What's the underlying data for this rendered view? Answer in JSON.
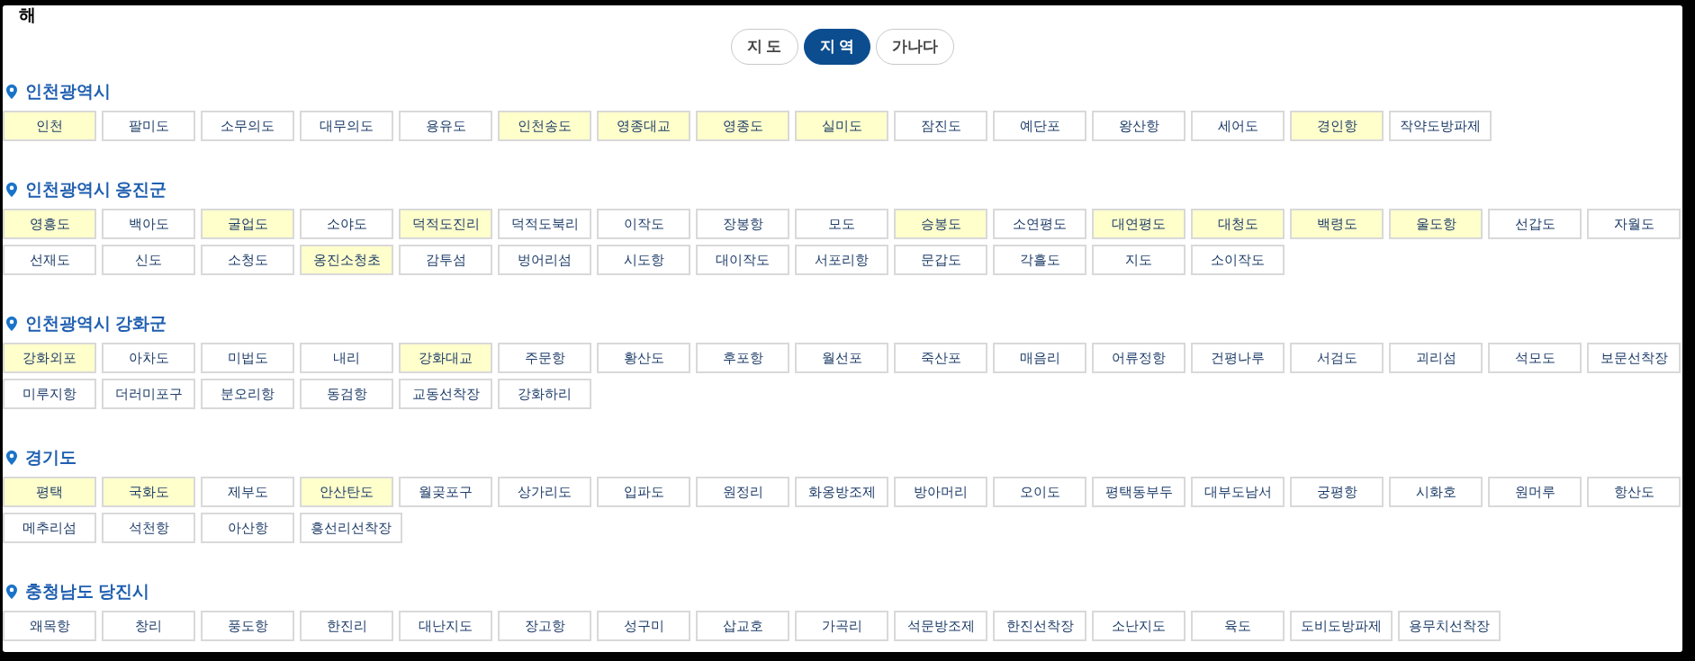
{
  "header": {
    "title": "해"
  },
  "view_tabs": [
    {
      "label": "지 도",
      "selected": false
    },
    {
      "label": "지 역",
      "selected": true
    },
    {
      "label": "가나다",
      "selected": false
    }
  ],
  "regions": [
    {
      "name": "인천광역시",
      "rows": [
        {
          "places": [
            {
              "label": "인천",
              "highlighted": true
            },
            {
              "label": "팔미도",
              "highlighted": false
            },
            {
              "label": "소무의도",
              "highlighted": false
            },
            {
              "label": "대무의도",
              "highlighted": false
            },
            {
              "label": "용유도",
              "highlighted": false
            },
            {
              "label": "인천송도",
              "highlighted": true
            },
            {
              "label": "영종대교",
              "highlighted": true
            },
            {
              "label": "영종도",
              "highlighted": true
            },
            {
              "label": "실미도",
              "highlighted": true
            },
            {
              "label": "잠진도",
              "highlighted": false
            },
            {
              "label": "예단포",
              "highlighted": false
            },
            {
              "label": "왕산항",
              "highlighted": false
            },
            {
              "label": "세어도",
              "highlighted": false
            },
            {
              "label": "경인항",
              "highlighted": true
            },
            {
              "label": "작약도방파제",
              "highlighted": false
            }
          ]
        }
      ]
    },
    {
      "name": "인천광역시 옹진군",
      "rows": [
        {
          "places": [
            {
              "label": "영흥도",
              "highlighted": true
            },
            {
              "label": "백아도",
              "highlighted": false
            },
            {
              "label": "굴업도",
              "highlighted": true
            },
            {
              "label": "소야도",
              "highlighted": false
            },
            {
              "label": "덕적도진리",
              "highlighted": true
            },
            {
              "label": "덕적도북리",
              "highlighted": false
            },
            {
              "label": "이작도",
              "highlighted": false
            },
            {
              "label": "장봉항",
              "highlighted": false
            },
            {
              "label": "모도",
              "highlighted": false
            },
            {
              "label": "승봉도",
              "highlighted": true
            },
            {
              "label": "소연평도",
              "highlighted": false
            },
            {
              "label": "대연평도",
              "highlighted": true
            },
            {
              "label": "대청도",
              "highlighted": true
            },
            {
              "label": "백령도",
              "highlighted": true
            },
            {
              "label": "울도항",
              "highlighted": true
            },
            {
              "label": "선갑도",
              "highlighted": false
            },
            {
              "label": "자월도",
              "highlighted": false
            }
          ]
        },
        {
          "places": [
            {
              "label": "선재도",
              "highlighted": false
            },
            {
              "label": "신도",
              "highlighted": false
            },
            {
              "label": "소청도",
              "highlighted": false
            },
            {
              "label": "옹진소청초",
              "highlighted": true
            },
            {
              "label": "감투섬",
              "highlighted": false
            },
            {
              "label": "벙어리섬",
              "highlighted": false
            },
            {
              "label": "시도항",
              "highlighted": false
            },
            {
              "label": "대이작도",
              "highlighted": false
            },
            {
              "label": "서포리항",
              "highlighted": false
            },
            {
              "label": "문갑도",
              "highlighted": false
            },
            {
              "label": "각흘도",
              "highlighted": false
            },
            {
              "label": "지도",
              "highlighted": false
            },
            {
              "label": "소이작도",
              "highlighted": false
            }
          ]
        }
      ]
    },
    {
      "name": "인천광역시 강화군",
      "rows": [
        {
          "places": [
            {
              "label": "강화외포",
              "highlighted": true
            },
            {
              "label": "아차도",
              "highlighted": false
            },
            {
              "label": "미법도",
              "highlighted": false
            },
            {
              "label": "내리",
              "highlighted": false
            },
            {
              "label": "강화대교",
              "highlighted": true
            },
            {
              "label": "주문항",
              "highlighted": false
            },
            {
              "label": "황산도",
              "highlighted": false
            },
            {
              "label": "후포항",
              "highlighted": false
            },
            {
              "label": "월선포",
              "highlighted": false
            },
            {
              "label": "죽산포",
              "highlighted": false
            },
            {
              "label": "매음리",
              "highlighted": false
            },
            {
              "label": "어류정항",
              "highlighted": false
            },
            {
              "label": "건평나루",
              "highlighted": false
            },
            {
              "label": "서검도",
              "highlighted": false
            },
            {
              "label": "괴리섬",
              "highlighted": false
            },
            {
              "label": "석모도",
              "highlighted": false
            },
            {
              "label": "보문선착장",
              "highlighted": false
            }
          ]
        },
        {
          "places": [
            {
              "label": "미루지항",
              "highlighted": false
            },
            {
              "label": "더러미포구",
              "highlighted": false
            },
            {
              "label": "분오리항",
              "highlighted": false
            },
            {
              "label": "동검항",
              "highlighted": false
            },
            {
              "label": "교동선착장",
              "highlighted": false
            },
            {
              "label": "강화하리",
              "highlighted": false
            }
          ]
        }
      ]
    },
    {
      "name": "경기도",
      "rows": [
        {
          "places": [
            {
              "label": "평택",
              "highlighted": true
            },
            {
              "label": "국화도",
              "highlighted": true
            },
            {
              "label": "제부도",
              "highlighted": false
            },
            {
              "label": "안산탄도",
              "highlighted": true
            },
            {
              "label": "월곶포구",
              "highlighted": false
            },
            {
              "label": "상가리도",
              "highlighted": false
            },
            {
              "label": "입파도",
              "highlighted": false
            },
            {
              "label": "원정리",
              "highlighted": false
            },
            {
              "label": "화옹방조제",
              "highlighted": false
            },
            {
              "label": "방아머리",
              "highlighted": false
            },
            {
              "label": "오이도",
              "highlighted": false
            },
            {
              "label": "평택동부두",
              "highlighted": false
            },
            {
              "label": "대부도남서",
              "highlighted": false
            },
            {
              "label": "궁평항",
              "highlighted": false
            },
            {
              "label": "시화호",
              "highlighted": false
            },
            {
              "label": "원머루",
              "highlighted": false
            },
            {
              "label": "항산도",
              "highlighted": false
            }
          ]
        },
        {
          "places": [
            {
              "label": "메추리섬",
              "highlighted": false
            },
            {
              "label": "석천항",
              "highlighted": false
            },
            {
              "label": "아산항",
              "highlighted": false
            },
            {
              "label": "흥선리선착장",
              "highlighted": false
            }
          ]
        }
      ]
    },
    {
      "name": "충청남도 당진시",
      "rows": [
        {
          "places": [
            {
              "label": "왜목항",
              "highlighted": false
            },
            {
              "label": "창리",
              "highlighted": false
            },
            {
              "label": "풍도항",
              "highlighted": false
            },
            {
              "label": "한진리",
              "highlighted": false
            },
            {
              "label": "대난지도",
              "highlighted": false
            },
            {
              "label": "장고항",
              "highlighted": false
            },
            {
              "label": "성구미",
              "highlighted": false
            },
            {
              "label": "삽교호",
              "highlighted": false
            },
            {
              "label": "가곡리",
              "highlighted": false
            },
            {
              "label": "석문방조제",
              "highlighted": false
            },
            {
              "label": "한진선착장",
              "highlighted": false
            },
            {
              "label": "소난지도",
              "highlighted": false
            },
            {
              "label": "육도",
              "highlighted": false
            },
            {
              "label": "도비도방파제",
              "highlighted": false
            },
            {
              "label": "용무치선착장",
              "highlighted": false
            }
          ]
        }
      ]
    }
  ]
}
